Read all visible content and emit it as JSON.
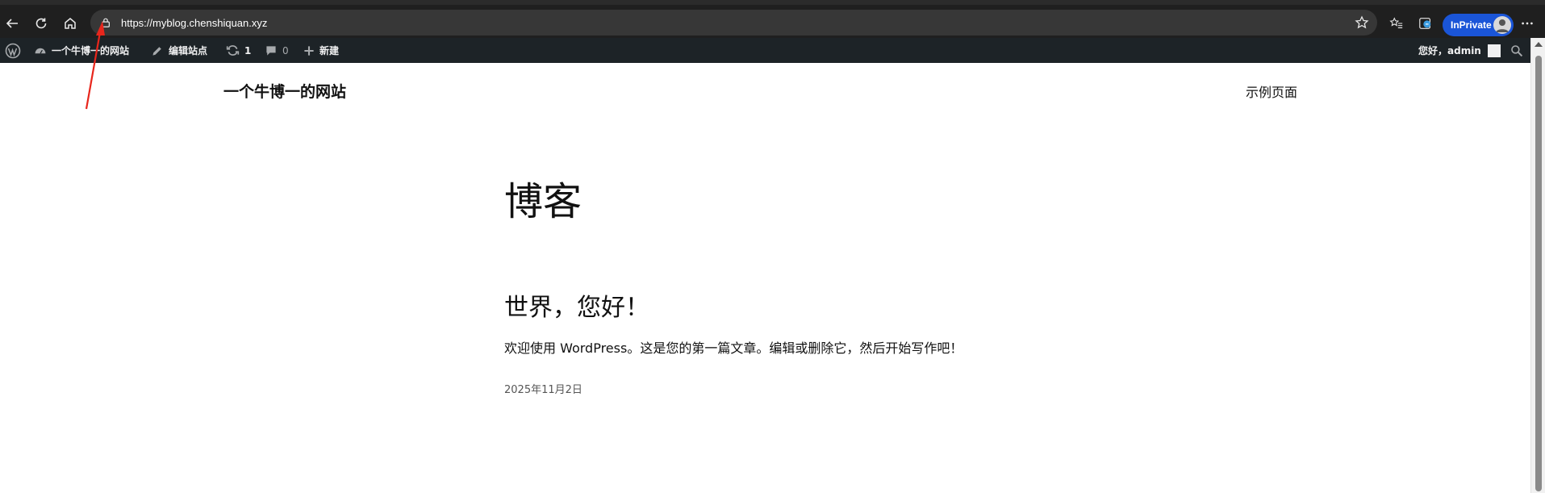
{
  "browser": {
    "url": "https://myblog.chenshiquan.xyz",
    "inprivate_label": "InPrivate",
    "accent_color": "#1a55d8"
  },
  "admin_bar": {
    "site_name": "一个牛博一的网站",
    "edit_site": "编辑站点",
    "updates_count": "1",
    "comments_count": "0",
    "new_label": "新建",
    "greeting": "您好，admin"
  },
  "site": {
    "title": "一个牛博一的网站",
    "nav_items": [
      "示例页面"
    ],
    "page_heading": "博客",
    "post": {
      "title": "世界，您好！",
      "excerpt": "欢迎使用 WordPress。这是您的第一篇文章。编辑或删除它，然后开始写作吧！",
      "date": "2025年11月2日"
    }
  },
  "icons": {
    "back": "arrow-left-icon",
    "refresh": "refresh-icon",
    "home": "home-icon",
    "lock": "lock-icon",
    "star": "star-icon",
    "favorites": "favorites-icon",
    "collections": "edge-icon",
    "menu": "more-icon",
    "wp_logo": "wordpress-icon",
    "dashboard": "dashboard-icon",
    "edit": "brush-icon",
    "updates": "updates-icon",
    "comments": "comment-icon",
    "new": "plus-icon",
    "search": "search-icon"
  }
}
